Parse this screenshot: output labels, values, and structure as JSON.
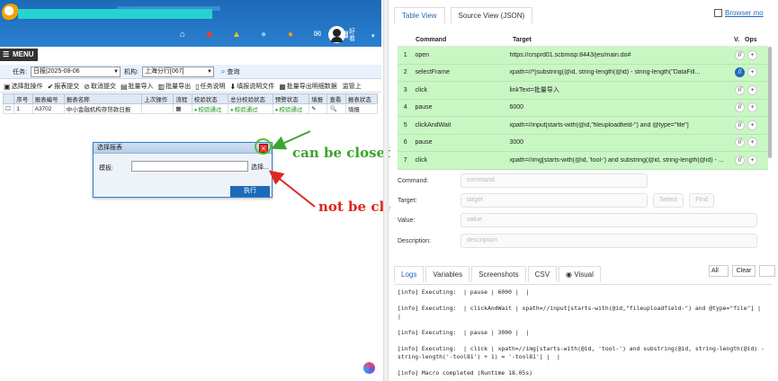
{
  "app": {
    "user_name": "好\n看",
    "menu_label": "MENU",
    "filter": {
      "task_label": "任务:",
      "task_value": "日报|2025-08-06",
      "org_label": "机构:",
      "org_value": "上海分行[067]",
      "query_label": "查询"
    },
    "toolbar": [
      {
        "icon": "select-batch-icon",
        "glyph": "▣",
        "label": "选择批操作"
      },
      {
        "icon": "check-icon",
        "glyph": "✔",
        "label": "报表提交"
      },
      {
        "icon": "cancel-icon",
        "glyph": "⊘",
        "label": "取消提交"
      },
      {
        "icon": "import-icon",
        "glyph": "▤",
        "label": "批量导入"
      },
      {
        "icon": "export-icon",
        "glyph": "▥",
        "label": "批量导出"
      },
      {
        "icon": "task-desc-icon",
        "glyph": "▯",
        "label": "任务说明"
      },
      {
        "icon": "download-icon",
        "glyph": "⬇",
        "label": "填报说明文件"
      },
      {
        "icon": "batch-export-icon",
        "glyph": "▦",
        "label": "批量导出明细数据"
      },
      {
        "icon": "monitor-icon",
        "glyph": "",
        "label": "监管上"
      }
    ],
    "grid": {
      "headers": [
        "",
        "序号",
        "报表编号",
        "报表名称",
        "上次操作",
        "流程",
        "校验状态",
        "总分校验状态",
        "预警状态",
        "填报",
        "查看",
        "报表状态"
      ],
      "rows": [
        [
          "☐",
          "1",
          "A3702",
          "中小金融机构存贷款日报",
          "",
          "▦",
          "校验通过",
          "校验通过",
          "校验通过",
          "✎",
          "🔍",
          "填报"
        ]
      ]
    },
    "dialog": {
      "title": "选择报表",
      "close": "×",
      "template_label": "模板:",
      "select_link": "选择...",
      "exec_button": "执行"
    },
    "annotations": {
      "can_be_closed": "can be closed",
      "not_be_clicked": "not be clicked"
    }
  },
  "uivision": {
    "tabs": [
      "Table View",
      "Source View (JSON)"
    ],
    "browser_mode": "Browser mo",
    "columns": {
      "command": "Command",
      "target": "Target",
      "value": "V.",
      "ops": "Ops"
    },
    "commands": [
      {
        "num": "1",
        "command": "open",
        "target": "https://crsprd01.scbmisp:8443/jes/main.do#"
      },
      {
        "num": "2",
        "command": "selectFrame",
        "target": "xpath=//*[substring(@id, string-length(@id) - string-length(\"DataFill..."
      },
      {
        "num": "3",
        "command": "click",
        "target": "linkText=批量导入"
      },
      {
        "num": "4",
        "command": "pause",
        "target": "6000"
      },
      {
        "num": "5",
        "command": "clickAndWait",
        "target": "xpath=//input[starts-with(@id,\"fileuploadfield-\") and @type=\"file\"]"
      },
      {
        "num": "6",
        "command": "pause",
        "target": "3000"
      },
      {
        "num": "7",
        "command": "click",
        "target": "xpath=//img[starts-with(@id, 'tool-') and substring(@id, string-length(@id) - ..."
      }
    ],
    "form": {
      "command_label": "Command:",
      "command_placeholder": "command",
      "target_label": "Target:",
      "target_placeholder": "target",
      "select_btn": "Select",
      "find_btn": "Find",
      "value_label": "Value:",
      "value_placeholder": "value",
      "description_label": "Description:",
      "description_placeholder": "description"
    },
    "log_tabs": [
      "Logs",
      "Variables",
      "Screenshots",
      "CSV",
      "Visual"
    ],
    "log_filter": "All",
    "log_clear": "Clear",
    "logs": [
      "[info] Executing:  | pause | 6000 |  |",
      "[info] Executing:  | clickAndWait | xpath=//input[starts-with(@id,\"fileuploadfield-\") and @type=\"file\"] |  |",
      "[info] Executing:  | pause | 3000 |  |",
      "[info] Executing:  | click | xpath=//img[starts-with(@id, 'tool-') and substring(@id, string-length(@id) -\nstring-length('-tool81') + 1) = '-tool81'] |  |",
      "[info] Macro completed (Runtime 18.05s)"
    ]
  }
}
